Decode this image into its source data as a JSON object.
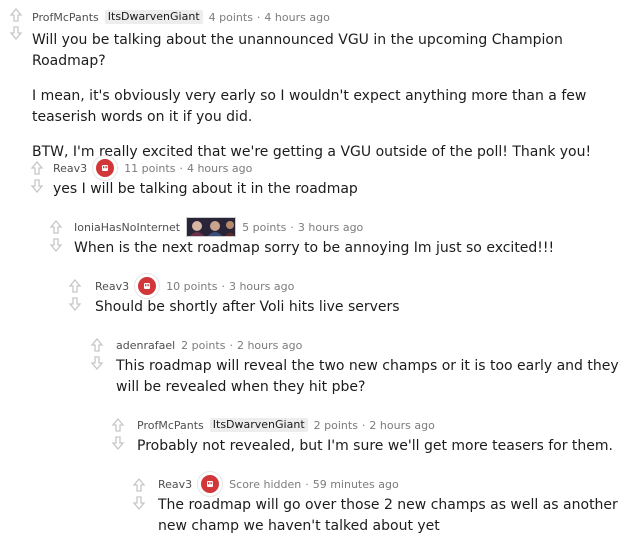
{
  "comments": [
    {
      "user": "ProfMcPants",
      "flair": "ItsDwarvenGiant",
      "points": "4 points",
      "time": "4 hours ago",
      "paragraphs": [
        "Will you be talking about the unannounced VGU in the upcoming Champion Roadmap?",
        "I mean, it's obviously very early so I wouldn't expect anything more than a few teaserish words on it if you did.",
        "BTW, I'm really excited that we're getting a VGU outside of the poll! Thank you!"
      ]
    },
    {
      "user": "Reav3",
      "badge": "riot-fist-icon",
      "points": "11 points",
      "time": "4 hours ago",
      "paragraphs": [
        "yes I will be talking about it in the roadmap"
      ]
    },
    {
      "user": "IoniaHasNoInternet",
      "badge": "champion-flair-image",
      "points": "5 points",
      "time": "3 hours ago",
      "paragraphs": [
        "When is the next roadmap sorry to be annoying Im just so excited!!!"
      ]
    },
    {
      "user": "Reav3",
      "badge": "riot-fist-icon",
      "points": "10 points",
      "time": "3 hours ago",
      "paragraphs": [
        "Should be shortly after Voli hits live servers"
      ]
    },
    {
      "user": "adenrafael",
      "points": "2 points",
      "time": "2 hours ago",
      "paragraphs": [
        "This roadmap will reveal the two new champs or it is too early and they will be revealed when they hit pbe?"
      ]
    },
    {
      "user": "ProfMcPants",
      "flair": "ItsDwarvenGiant",
      "points": "2 points",
      "time": "2 hours ago",
      "paragraphs": [
        "Probably not revealed, but I'm sure we'll get more teasers for them."
      ]
    },
    {
      "user": "Reav3",
      "badge": "riot-fist-icon",
      "points": "Score hidden",
      "time": "59 minutes ago",
      "paragraphs": [
        "The roadmap will go over those 2 new champs as well as another new champ we haven't talked about yet"
      ]
    }
  ],
  "colors": {
    "riot_red": "#d13639",
    "meta_grey": "#7c7c7c",
    "arrow_grey": "#c6c6c6"
  },
  "separator": "·"
}
